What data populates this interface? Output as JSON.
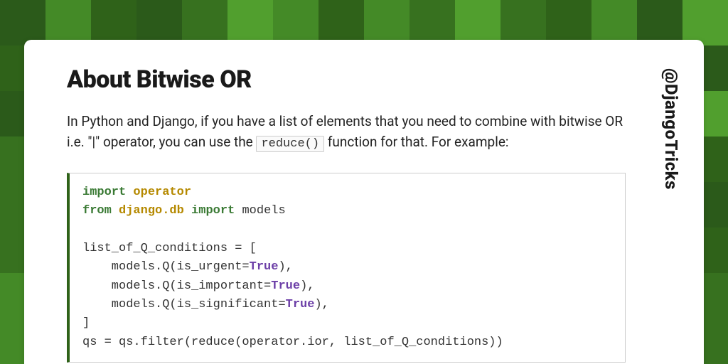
{
  "handle": "@DjangoTricks",
  "title": "About Bitwise OR",
  "intro_before": "In Python and Django, if you have a list of elements that you need to combine with bitwise OR i.e. \"|\" operator, you can use the ",
  "inline_code": "reduce()",
  "intro_after": " function for that. For example:",
  "code": {
    "kw_import": "import",
    "nm_operator": "operator",
    "kw_from": "from",
    "nm_djangodb": "django.db",
    "kw_import2": "import",
    "txt_models": " models",
    "blank": "",
    "line_listopen": "list_of_Q_conditions = [",
    "q_prefix0": "    models.Q(is_urgent=",
    "q_prefix1": "    models.Q(is_important=",
    "q_prefix2": "    models.Q(is_significant=",
    "bool_true": "True",
    "q_suffix": "),",
    "line_listclose": "]",
    "line_qs": "qs = qs.filter(reduce(operator.ior, list_of_Q_conditions))"
  }
}
